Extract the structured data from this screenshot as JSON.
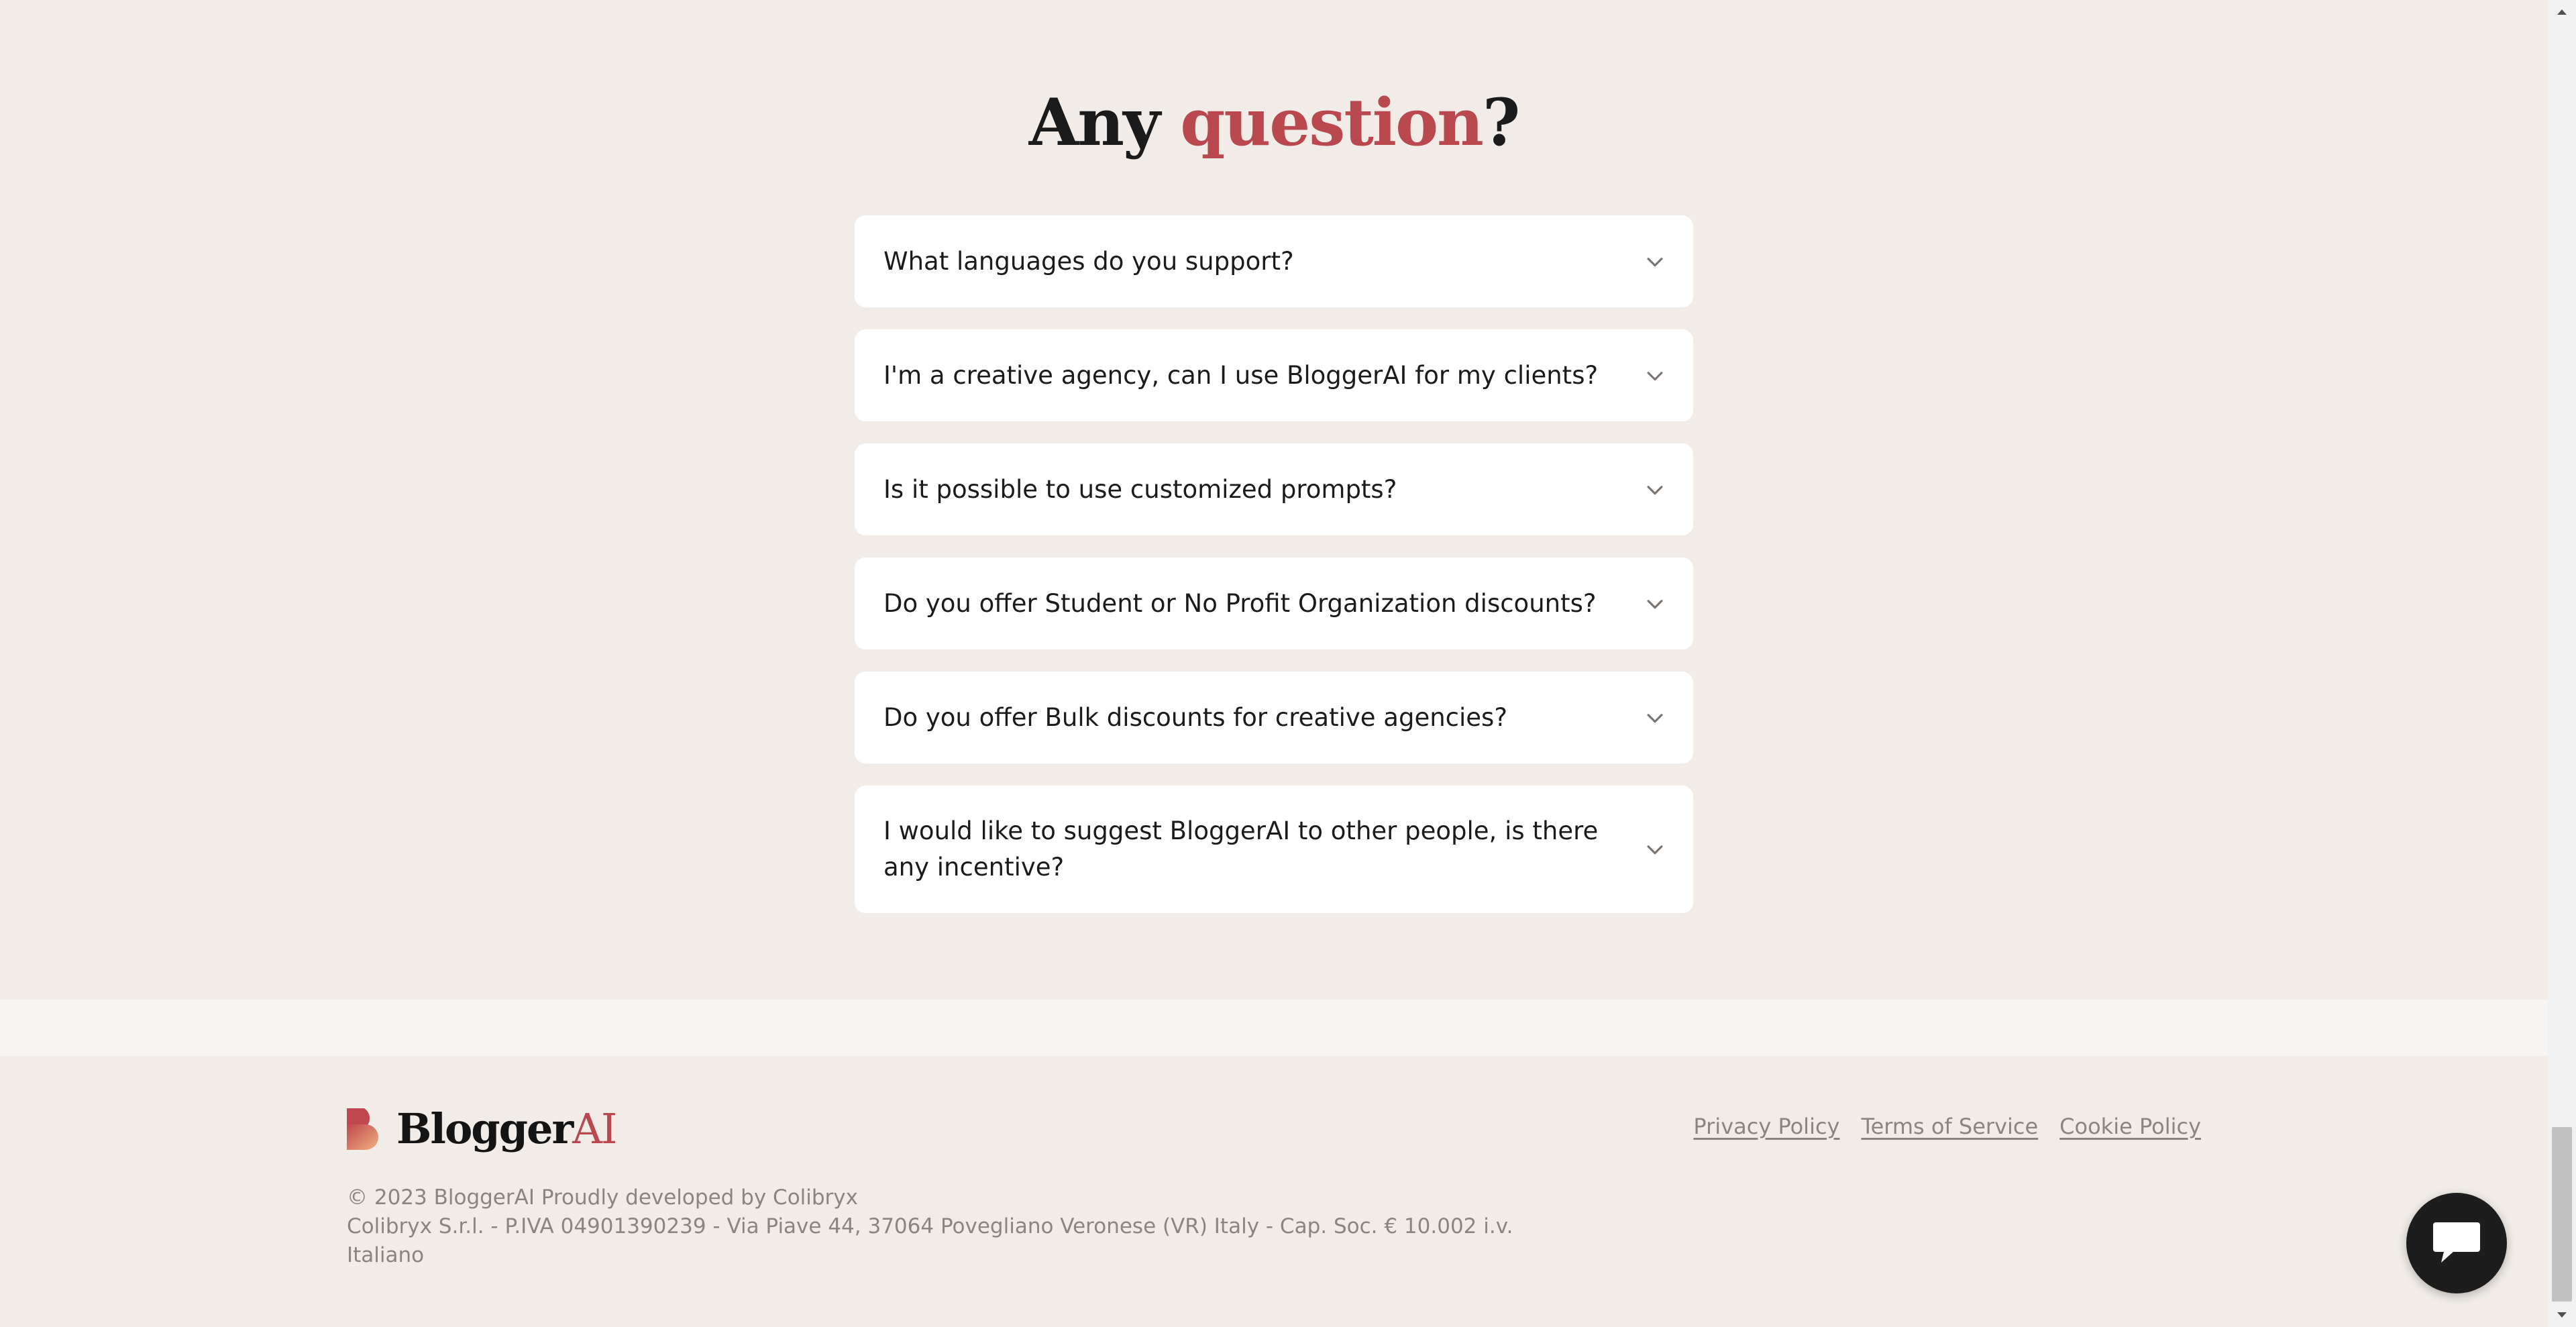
{
  "faq": {
    "title_pre": "Any ",
    "title_accent": "question",
    "title_post": "?",
    "items": [
      {
        "question": "What languages do you support?"
      },
      {
        "question": "I'm a creative agency, can I use BloggerAI for my clients?"
      },
      {
        "question": "Is it possible to use customized prompts?"
      },
      {
        "question": "Do you offer Student or No Profit Organization discounts?"
      },
      {
        "question": "Do you offer Bulk discounts for creative agencies?"
      },
      {
        "question": "I would like to suggest BloggerAI to other people, is there any incentive?"
      }
    ]
  },
  "footer": {
    "logo_text_main": "Blogger",
    "logo_text_accent": "AI",
    "links": {
      "privacy": "Privacy Policy",
      "terms": "Terms of Service",
      "cookie": "Cookie Policy"
    },
    "copyright": "© 2023 BloggerAI Proudly developed by Colibryx",
    "company": "Colibryx S.r.l. - P.IVA 04901390239 - Via Piave 44, 37064 Povegliano Veronese (VR) Italy - Cap. Soc. € 10.002 i.v.",
    "language": "Italiano"
  },
  "colors": {
    "background": "#f1ece8",
    "accent": "#b9484f",
    "card": "#ffffff",
    "text": "#1b1b1b",
    "muted": "#8d8480",
    "chat_button": "#1d1d1d"
  },
  "icons": {
    "faq_toggle": "chevron-down-icon",
    "chat": "chat-bubble-icon",
    "logo": "bloggerai-logo-mark"
  }
}
